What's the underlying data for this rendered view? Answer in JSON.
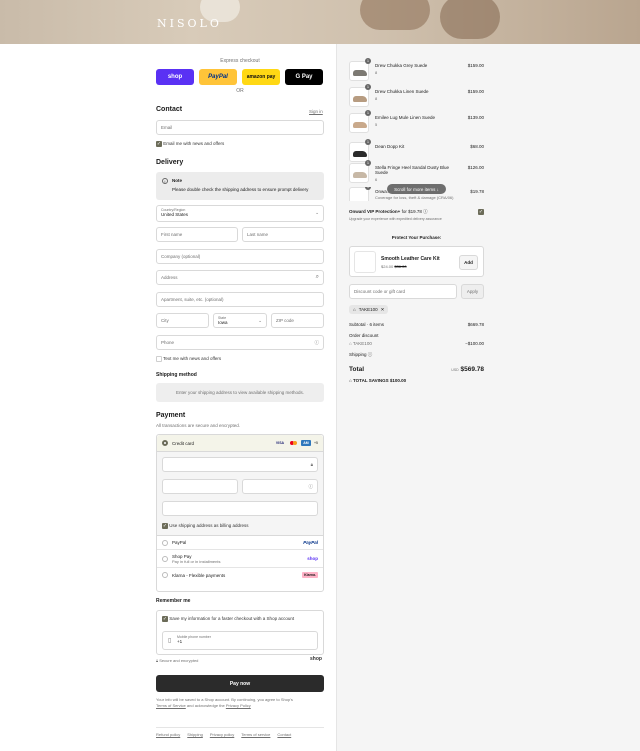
{
  "brand": {
    "logo": "NISOLO"
  },
  "express": {
    "label": "Express checkout",
    "shop": "shop",
    "paypal": "PayPal",
    "amazon": "amazon pay",
    "gpay": "G Pay",
    "or": "OR"
  },
  "contact": {
    "title": "Contact",
    "sign_in": "Sign in",
    "email_placeholder": "Email",
    "news_label": "Email me with news and offers"
  },
  "delivery": {
    "title": "Delivery",
    "note_title": "Note",
    "note_text": "Please double check the shipping address to ensure prompt delivery",
    "country_label": "Country/Region",
    "country_value": "United States",
    "first_name": "First name",
    "last_name": "Last name",
    "company": "Company (optional)",
    "address": "Address",
    "apartment": "Apartment, suite, etc. (optional)",
    "city": "City",
    "state_label": "State",
    "state_value": "Iowa",
    "zip": "ZIP code",
    "phone": "Phone",
    "text_label": "Text me with news and offers"
  },
  "shipping": {
    "title": "Shipping method",
    "message": "Enter your shipping address to view available shipping methods."
  },
  "payment": {
    "title": "Payment",
    "subtitle": "All transactions are secure and encrypted.",
    "credit_card": "Credit card",
    "card_more": "+5",
    "billing_label": "Use shipping address as billing address",
    "paypal": "PayPal",
    "paypal_logo": "PayPal",
    "shop_pay": "Shop Pay",
    "shop_pay_sub": "Pay in full or in installments",
    "shop_logo": "shop",
    "klarna": "Klarna - Flexible payments",
    "klarna_logo": "Klarna."
  },
  "remember": {
    "title": "Remember me",
    "save_label": "Save my information for a faster checkout with a Shop account",
    "mobile_label": "Mobile phone number",
    "mobile_value": "+1",
    "secure": "Secure and encrypted",
    "shop_logo": "shop"
  },
  "pay_now": "Pay now",
  "legal": {
    "text": "Your info will be saved to a Shop account. By continuing, you agree to Shop's",
    "terms": "Terms of Service",
    "and": "and acknowledge the",
    "privacy": "Privacy Policy"
  },
  "footer": [
    "Refund policy",
    "Shipping",
    "Privacy policy",
    "Terms of service",
    "Contact"
  ],
  "cart": {
    "items": [
      {
        "qty": "1",
        "name": "Drew Chukka Grey Suede",
        "variant": "8",
        "price": "$159.00",
        "color": "#7d7a73"
      },
      {
        "qty": "1",
        "name": "Drew Chukka Linen Suede",
        "variant": "8",
        "price": "$159.00",
        "color": "#b79c81"
      },
      {
        "qty": "1",
        "name": "Emilee Lug Mule Linen Suede",
        "variant": "5",
        "price": "$139.00",
        "color": "#c9a98b"
      },
      {
        "qty": "1",
        "name": "Dean Dopp Kit",
        "variant": "",
        "price": "$68.00",
        "color": "#2b2b2b"
      },
      {
        "qty": "1",
        "name": "Stella Fringe Heel Sandal Dusty Blue Suede",
        "variant": "6",
        "price": "$126.00",
        "color": "#c7b8a6"
      },
      {
        "qty": "1",
        "name": "Onwa...",
        "variant": "Coverage for loss, theft & damage (CRA/06)",
        "price": "$19.78",
        "color": "#ffffff"
      }
    ],
    "scroll_hint": "Scroll for more items",
    "protection_title": "Onward VIP Protection+",
    "protection_price": "for $19.78",
    "protection_desc": "Upgrade your experience with expedited delivery assurance",
    "protect_heading": "Protect Your Purchase:",
    "upsell": {
      "name": "Smooth Leather Care Kit",
      "price": "$24.00",
      "compare": "$36.00",
      "add": "Add"
    },
    "discount_placeholder": "Discount code or gift card",
    "apply": "Apply",
    "code_chip": "TAKE100",
    "subtotal_label": "Subtotal · 6 items",
    "subtotal": "$669.78",
    "order_discount": "Order discount",
    "discount_code": "TAKE100",
    "discount_amount": "−$100.00",
    "shipping_label": "Shipping",
    "total_label": "Total",
    "currency": "USD",
    "total": "$569.78",
    "savings_label": "TOTAL SAVINGS",
    "savings": "$100.00"
  }
}
